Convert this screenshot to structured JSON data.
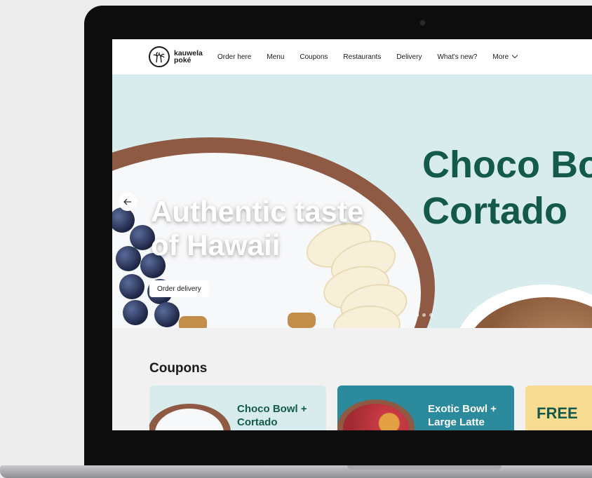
{
  "nav": {
    "logo_line1": "kauwela",
    "logo_line2": "poké",
    "items": [
      "Order here",
      "Menu",
      "Coupons",
      "Restaurants",
      "Delivery",
      "What's new?"
    ],
    "more_label": "More"
  },
  "hero": {
    "headline_line1": "Authentic taste",
    "headline_line2": "of Hawaii",
    "order_button": "Order delivery",
    "promo_line1": "Choco Bo",
    "promo_line2": "Cortado",
    "slide_count": 3,
    "active_slide": 1
  },
  "coupons": {
    "title": "Coupons",
    "cards": [
      {
        "line1": "Choco Bowl +",
        "line2": "Cortado"
      },
      {
        "line1": "Exotic Bowl +",
        "line2": "Large Latte"
      },
      {
        "line1": "FREE",
        "line2": ""
      }
    ]
  },
  "colors": {
    "brand_green": "#145a4a",
    "hero_bg": "#d8ecee",
    "teal_card": "#2b8a9c",
    "yellow_card": "#f7dc92"
  }
}
